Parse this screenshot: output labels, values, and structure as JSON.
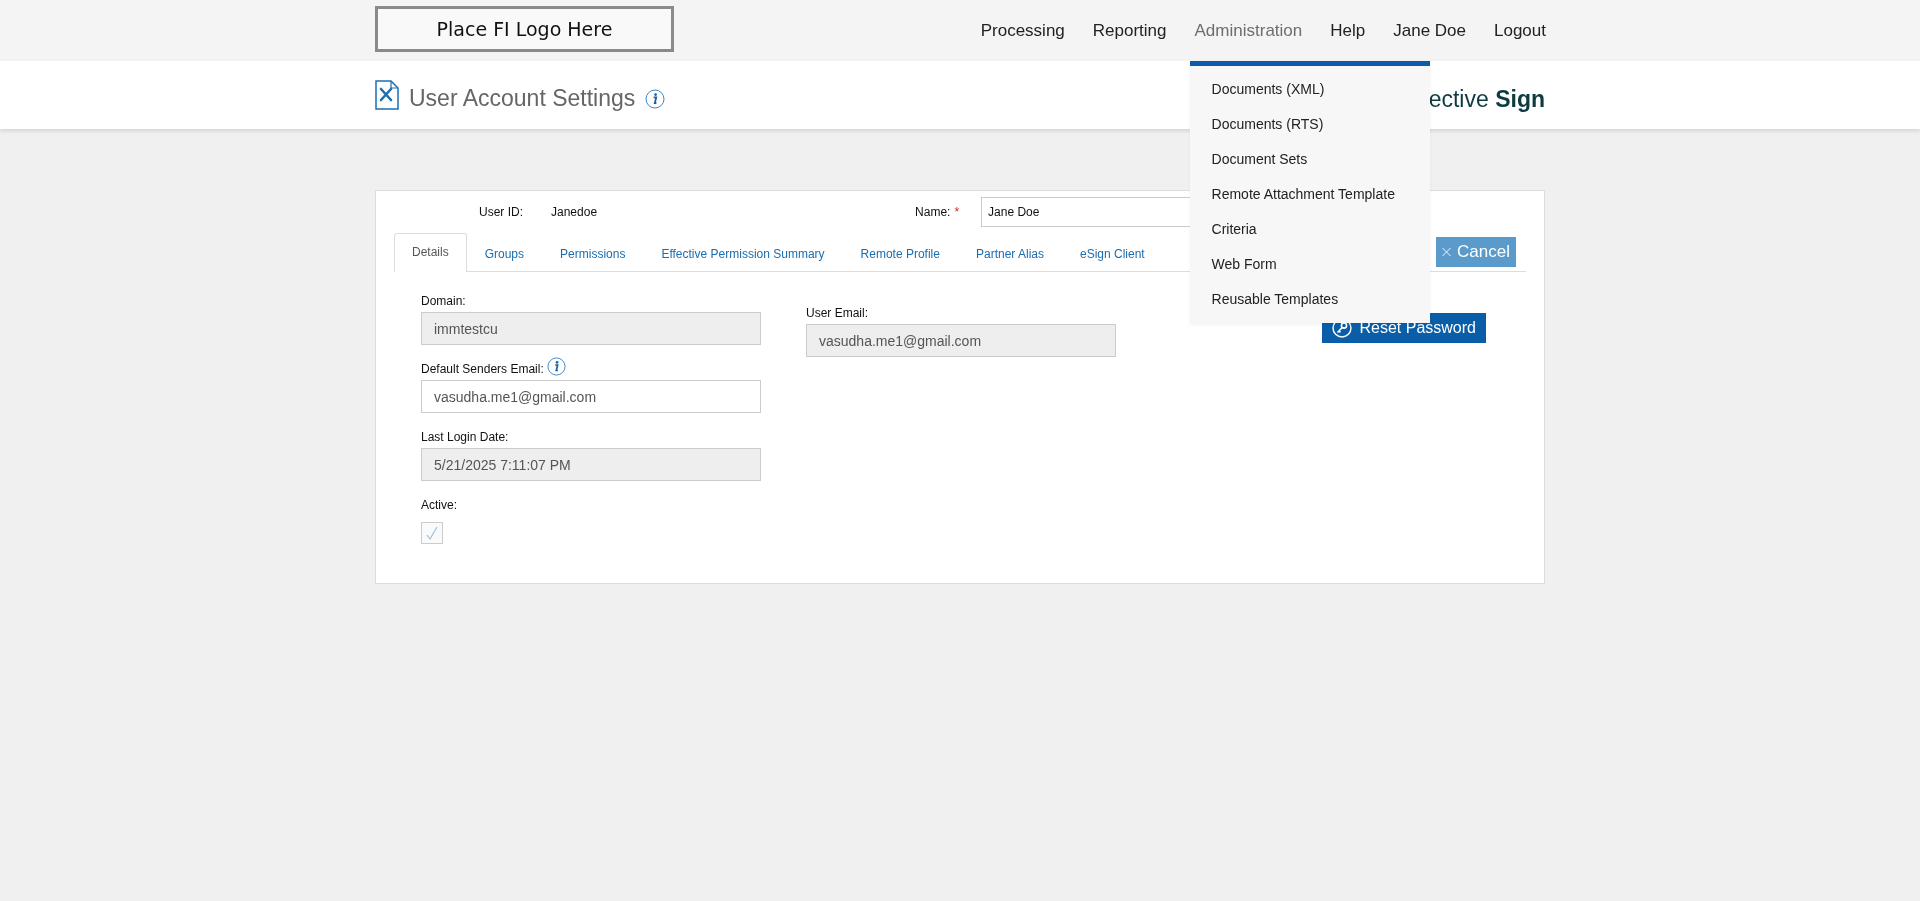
{
  "logo": {
    "text": "Place FI Logo Here"
  },
  "nav": [
    {
      "label": "Processing",
      "expanded": false
    },
    {
      "label": "Reporting",
      "expanded": false
    },
    {
      "label": "Administration",
      "expanded": true
    },
    {
      "label": "Help",
      "expanded": false
    },
    {
      "label": "Jane Doe",
      "expanded": false
    },
    {
      "label": "Logout",
      "expanded": false
    }
  ],
  "admin_menu": [
    "Documents (XML)",
    "Documents (RTS)",
    "Document Sets",
    "Remote Attachment Template",
    "Criteria",
    "Web Form",
    "Reusable Templates"
  ],
  "page_title": "User Account Settings",
  "brand": "ective **Sign**",
  "user_id": {
    "label": "User ID:",
    "value": "Janedoe"
  },
  "name": {
    "label": "Name:",
    "required_mark": "*",
    "value": "Jane Doe"
  },
  "tabs": [
    {
      "label": "Details",
      "selected": true
    },
    {
      "label": "Groups",
      "selected": false
    },
    {
      "label": "Permissions",
      "selected": false
    },
    {
      "label": "Effective Permission Summary",
      "selected": false
    },
    {
      "label": "Remote Profile",
      "selected": false
    },
    {
      "label": "Partner Alias",
      "selected": false
    },
    {
      "label": "eSign Client",
      "selected": false
    }
  ],
  "cancel_button": "Cancel",
  "reset_button": "Reset Password",
  "left_fields": [
    {
      "label": "Domain:",
      "value": "immtestcu",
      "disabled": true,
      "info": false
    },
    {
      "label": "Default Senders Email:",
      "value": "vasudha.me1@gmail.com",
      "disabled": false,
      "info": true
    },
    {
      "label": "Last Login Date:",
      "value": "5/21/2025 7:11:07 PM",
      "disabled": true,
      "info": false
    }
  ],
  "right_fields": [
    {
      "label": "User Email:",
      "value": "vasudha.me1@gmail.com",
      "disabled": true
    }
  ],
  "active": {
    "label": "Active:",
    "checked": true,
    "disabled": true
  }
}
